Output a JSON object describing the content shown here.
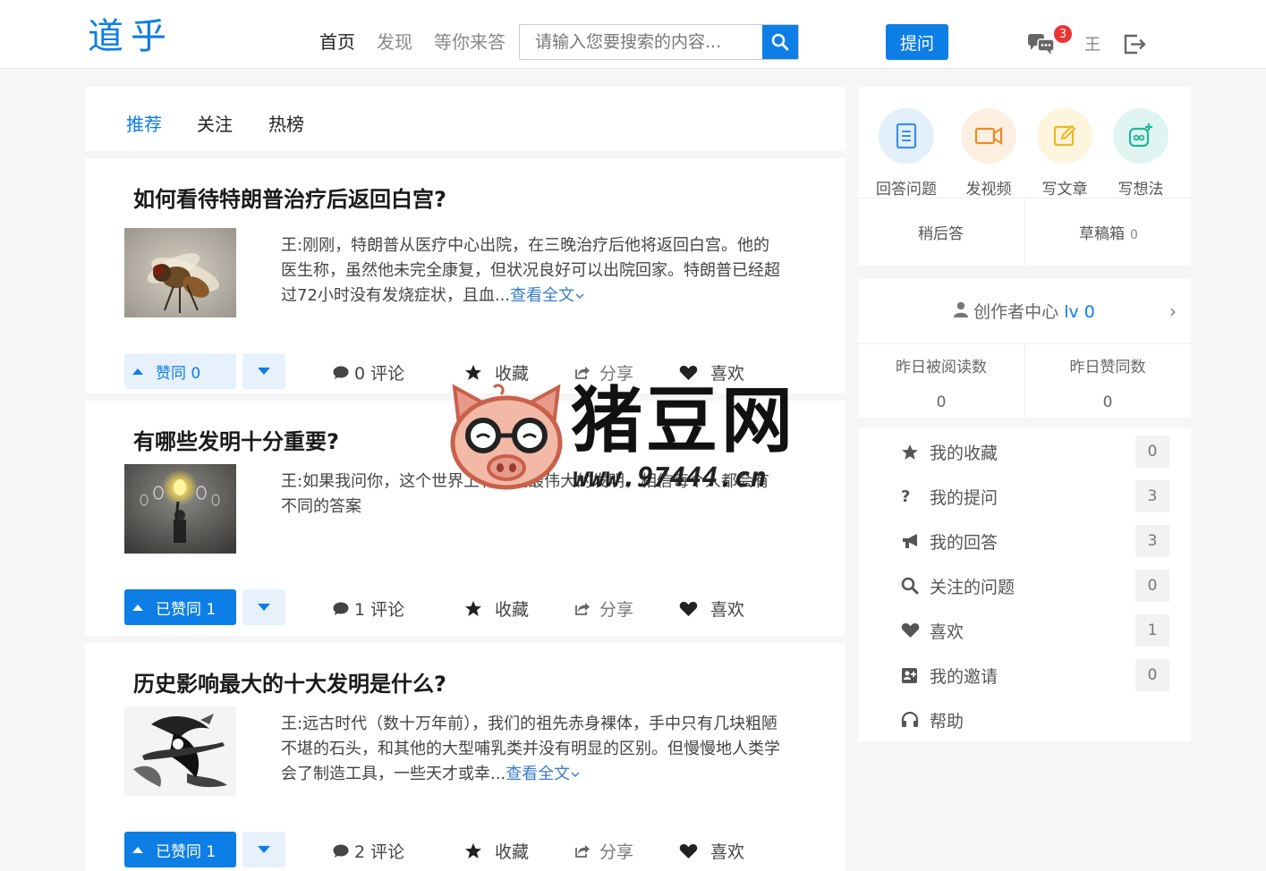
{
  "header": {
    "logo": "道乎",
    "nav": [
      "首页",
      "发现",
      "等你来答"
    ],
    "search_placeholder": "请输入您要搜索的内容...",
    "ask_label": "提问",
    "message_count": "3",
    "user_name": "王"
  },
  "tabs": [
    "推荐",
    "关注",
    "热榜"
  ],
  "questions": [
    {
      "title": "如何看待特朗普治疗后返回白宫?",
      "excerpt": "王:刚刚，特朗普从医疗中心出院，在三晚治疗后他将返回白宫。他的医生称，虽然他未完全康复，但状况良好可以出院回家。特朗普已经超过72小时没有发烧症状，且血...",
      "more": "查看全文",
      "vote_label": "赞同 0",
      "comments": "0 评论",
      "favorite": "收藏",
      "share": "分享",
      "like": "喜欢"
    },
    {
      "title": "有哪些发明十分重要?",
      "excerpt": "王:如果我问你，这个世界上有哪些最伟大的发明，相信每个人都会有不同的答案",
      "more": "",
      "vote_label": "已赞同 1",
      "comments": "1 评论",
      "favorite": "收藏",
      "share": "分享",
      "like": "喜欢"
    },
    {
      "title": "历史影响最大的十大发明是什么?",
      "excerpt": "王:远古时代（数十万年前），我们的祖先赤身裸体，手中只有几块粗陋不堪的石头，和其他的大型哺乳类并没有明显的区别。但慢慢地人类学会了制造工具，一些天才或幸...",
      "more": "查看全文",
      "vote_label": "已赞同 1",
      "comments": "2 评论",
      "favorite": "收藏",
      "share": "分享",
      "like": "喜欢"
    }
  ],
  "quick_actions": [
    "回答问题",
    "发视频",
    "写文章",
    "写想法"
  ],
  "drafts": {
    "later_label": "稍后答",
    "draft_label": "草稿箱",
    "draft_count": "0"
  },
  "creator": {
    "title": "创作者中心",
    "level": "lv 0",
    "reads_label": "昨日被阅读数",
    "reads_value": "0",
    "likes_label": "昨日赞同数",
    "likes_value": "0"
  },
  "menu": [
    {
      "label": "我的收藏",
      "count": "0",
      "icon": "star-icon"
    },
    {
      "label": "我的提问",
      "count": "3",
      "icon": "question-icon"
    },
    {
      "label": "我的回答",
      "count": "3",
      "icon": "bullhorn-icon"
    },
    {
      "label": "关注的问题",
      "count": "0",
      "icon": "search-icon"
    },
    {
      "label": "喜欢",
      "count": "1",
      "icon": "heart-icon"
    },
    {
      "label": "我的邀请",
      "count": "0",
      "icon": "invite-icon"
    },
    {
      "label": "帮助",
      "count": "",
      "icon": "headphones-icon"
    }
  ],
  "watermark": {
    "name": "猪豆网",
    "url": "www.97444.cn"
  },
  "colors": {
    "accent": "#0d7ee6",
    "badge": "#e33333"
  }
}
